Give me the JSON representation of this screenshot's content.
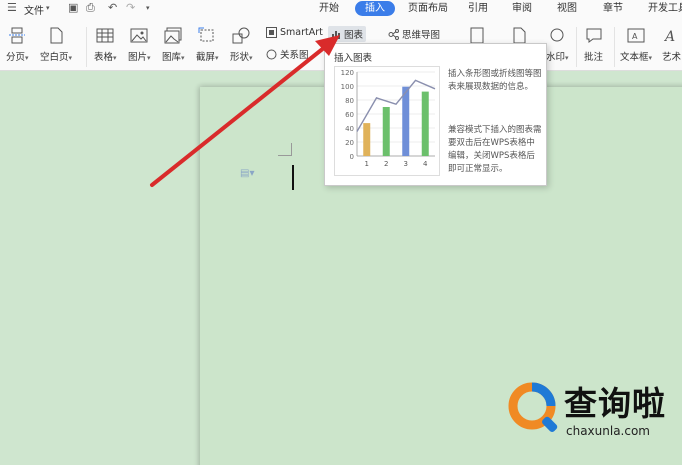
{
  "menubar": {
    "file": "文件",
    "tabs": [
      "开始",
      "插入",
      "页面布局",
      "引用",
      "审阅",
      "视图",
      "章节",
      "开发工具"
    ],
    "active_tab": "插入",
    "active_color": "#3b7de9"
  },
  "ribbon": {
    "page_break": "分页",
    "blank_page": "空白页",
    "table": "表格",
    "picture": "图片",
    "gallery": "图库",
    "screenshot": "截屏",
    "shape": "形状",
    "smartart": "SmartArt",
    "chart": "图表",
    "mindmap": "思维导图",
    "relation": "关系图",
    "partial_label": "水印",
    "comment": "批注",
    "textbox": "文本框",
    "wordart": "艺术"
  },
  "tooltip": {
    "title": "插入图表",
    "desc1": "插入条形图或折线图等图表来展现数据的信息。",
    "desc2": "兼容模式下插入的图表需要双击后在WPS表格中编辑，关闭WPS表格后即可正常显示。"
  },
  "chart_data": {
    "type": "bar",
    "categories": [
      "1",
      "2",
      "3",
      "4"
    ],
    "values": [
      47,
      70,
      99,
      92
    ],
    "line_values": [
      35,
      83,
      74,
      108,
      96
    ],
    "bar_colors": [
      "#e0b25a",
      "#6cc06c",
      "#6f8fd8",
      "#6cc06c"
    ],
    "line_color": "#8a8fae",
    "y_ticks": [
      "120",
      "100",
      "80",
      "60",
      "40",
      "20",
      "0"
    ],
    "ylim": [
      0,
      120
    ]
  },
  "watermark": {
    "text": "查询啦",
    "url": "chaxunla.com",
    "brand_orange": "#f08a24",
    "brand_blue": "#1f7ad6"
  },
  "arrow_color": "#d92b2b"
}
